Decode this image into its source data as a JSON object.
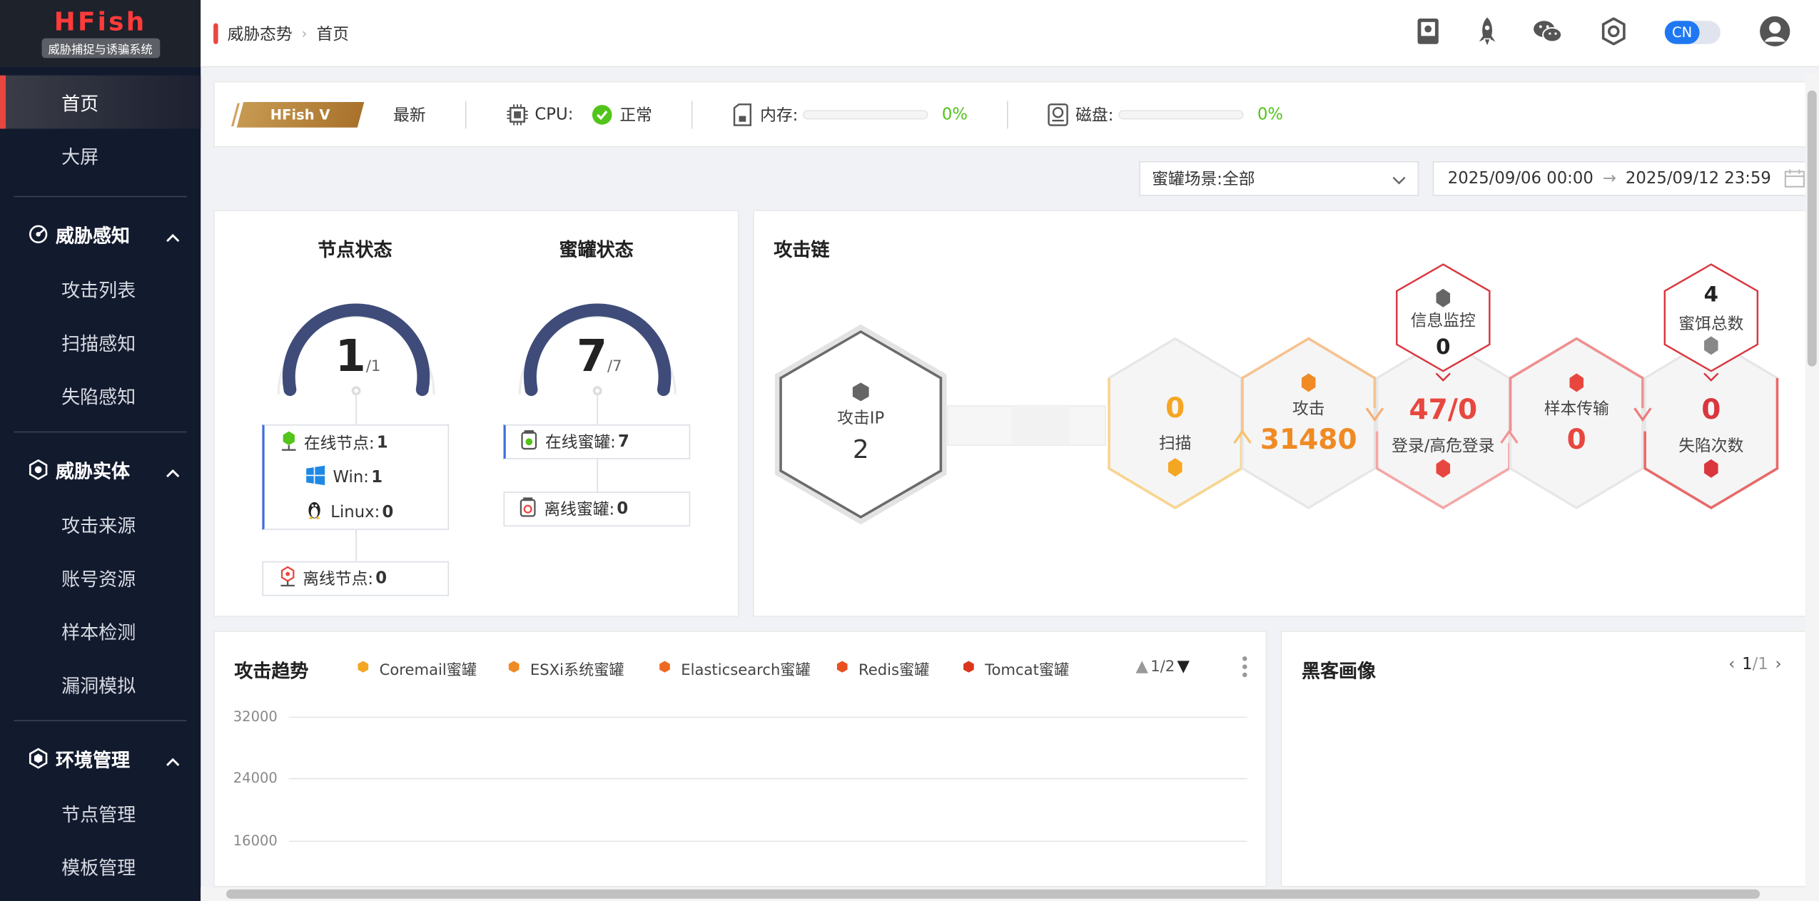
{
  "app": {
    "name": "HFish",
    "tagline": "威胁捕捉与诱骗系统"
  },
  "breadcrumb": {
    "parent": "威胁态势",
    "current": "首页"
  },
  "topbar": {
    "lang_label": "CN"
  },
  "sidebar": {
    "home": "首页",
    "bigscreen": "大屏",
    "groups": [
      {
        "label": "威胁感知",
        "items": [
          "攻击列表",
          "扫描感知",
          "失陷感知"
        ]
      },
      {
        "label": "威胁实体",
        "items": [
          "攻击来源",
          "账号资源",
          "样本检测",
          "漏洞模拟"
        ]
      },
      {
        "label": "环境管理",
        "items": [
          "节点管理",
          "模板管理"
        ]
      }
    ]
  },
  "status": {
    "version_label": "HFish V",
    "version_state": "最新",
    "cpu_label": "CPU:",
    "cpu_state": "正常",
    "mem_label": "内存:",
    "mem_value": "0%",
    "mem_fraction": 0,
    "disk_label": "磁盘:",
    "disk_value": "0%",
    "disk_fraction": 0
  },
  "filters": {
    "scene_label": "蜜罐场景:",
    "scene_value": "全部",
    "date_start": "2025/09/06 00:00",
    "date_end": "2025/09/12 23:59"
  },
  "node_status": {
    "title": "节点状态",
    "value": "1",
    "total": "/1",
    "online_label": "在线节点:",
    "online_value": "1",
    "win_label": "Win:",
    "win_value": "1",
    "linux_label": "Linux:",
    "linux_value": "0",
    "offline_label": "离线节点:",
    "offline_value": "0"
  },
  "honeypot_status": {
    "title": "蜜罐状态",
    "value": "7",
    "total": "/7",
    "online_label": "在线蜜罐:",
    "online_value": "7",
    "offline_label": "离线蜜罐:",
    "offline_value": "0"
  },
  "attack_chain": {
    "title": "攻击链",
    "attack_ip_label": "攻击IP",
    "attack_ip_value": "2",
    "scan_value": "0",
    "scan_label": "扫描",
    "attack_label": "攻击",
    "attack_value": "31480",
    "login_value": "47/0",
    "login_label": "登录/高危登录",
    "info_label": "信息监控",
    "info_value": "0",
    "sample_label": "样本传输",
    "sample_value": "0",
    "bait_value": "4",
    "bait_label": "蜜饵总数",
    "fall_value": "0",
    "fall_label": "失陷次数"
  },
  "trend": {
    "title": "攻击趋势",
    "legend": [
      {
        "name": "Coremail蜜罐",
        "color": "#f5a623"
      },
      {
        "name": "ESXi系统蜜罐",
        "color": "#f08a24"
      },
      {
        "name": "Elasticsearch蜜罐",
        "color": "#ee6a22"
      },
      {
        "name": "Redis蜜罐",
        "color": "#e9501f"
      },
      {
        "name": "Tomcat蜜罐",
        "color": "#d9361c"
      }
    ],
    "pager": "1/2",
    "yticks": [
      "32000",
      "24000",
      "16000"
    ]
  },
  "hacker": {
    "title": "黑客画像",
    "page_current": "1",
    "page_total": "/1"
  }
}
